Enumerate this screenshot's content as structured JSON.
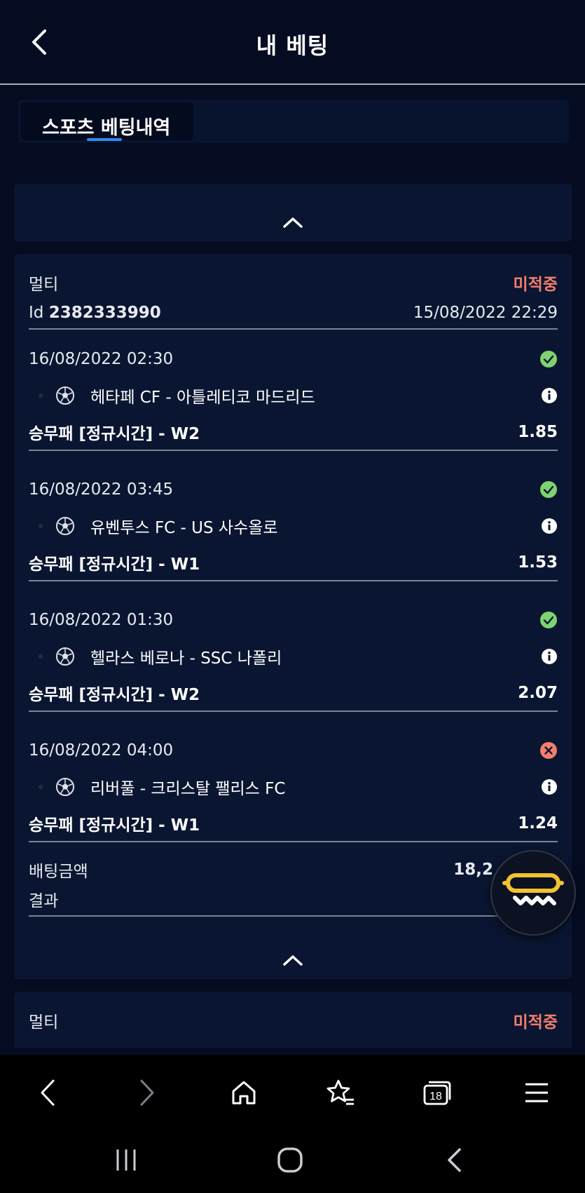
{
  "header": {
    "title": "내 베팅"
  },
  "tabs": [
    {
      "label": "스포츠 베팅내역",
      "active": true
    }
  ],
  "bet": {
    "type": "멀티",
    "status": "미적중",
    "id_label": "Id",
    "id_value": "2382333990",
    "placed_at": "15/08/2022 22:29",
    "selections": [
      {
        "datetime": "16/08/2022 02:30",
        "result": "won",
        "match": "헤타페 CF - 아틀레티코 마드리드",
        "market": "승무패 [정규시간] - W2",
        "odds": "1.85"
      },
      {
        "datetime": "16/08/2022 03:45",
        "result": "won",
        "match": "유벤투스 FC - US 사수올로",
        "market": "승무패 [정규시간] - W1",
        "odds": "1.53"
      },
      {
        "datetime": "16/08/2022 01:30",
        "result": "won",
        "match": "헬라스 베로나 - SSC 나폴리",
        "market": "승무패 [정규시간] - W2",
        "odds": "2.07"
      },
      {
        "datetime": "16/08/2022 04:00",
        "result": "lost",
        "match": "리버풀 - 크리스탈 팰리스 FC",
        "market": "승무패 [정규시간] - W1",
        "odds": "1.24"
      }
    ],
    "stake_label": "배팅금액",
    "stake_value": "18,2",
    "result_label": "결과"
  },
  "bet2": {
    "type": "멀티",
    "status": "미적중"
  },
  "colors": {
    "background": "#050c22",
    "card": "#0a1631",
    "won": "#7ed36f",
    "lost": "#f47e6c",
    "accent": "#2a8cf0",
    "fab_logo": "#f2c230"
  },
  "icons": {
    "back": "chevron-left-icon",
    "collapse": "chevron-up-icon",
    "sport": "soccer-ball-icon",
    "info": "info-icon",
    "won": "check-circle-icon",
    "lost": "x-circle-icon"
  },
  "browser": {
    "tab_count": "18"
  }
}
